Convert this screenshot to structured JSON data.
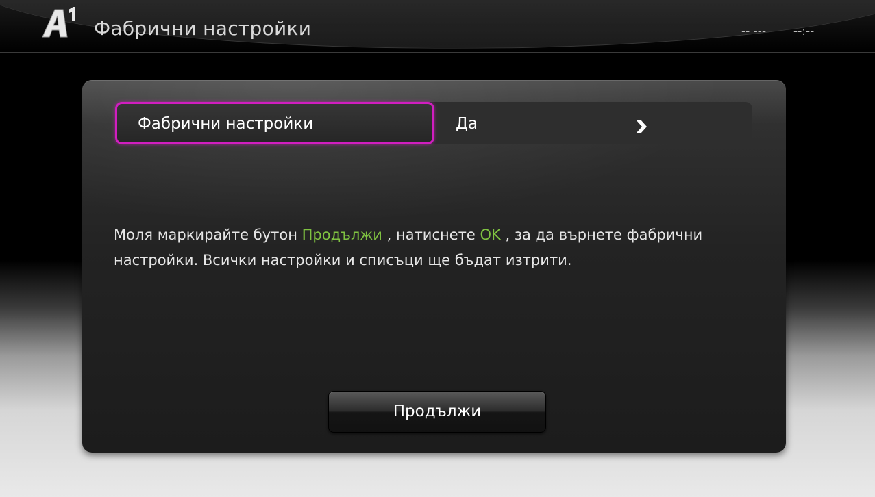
{
  "header": {
    "logo_text": "A1",
    "title": "Фабрични настройки",
    "date": "-- ---",
    "time": "--:--"
  },
  "setting": {
    "label": "Фабрични настройки",
    "value": "Да",
    "arrow_icon": "chevron-right-icon"
  },
  "message": {
    "part1": "Моля маркирайте бутон ",
    "highlight1": "Продължи",
    "part2": " , натиснете ",
    "highlight2": "OK",
    "part3": " , за да върнете фабрични настройки. Всички настройки и списъци ще бъдат изтрити."
  },
  "buttons": {
    "continue_label": "Продължи"
  },
  "colors": {
    "focus_border": "#d11ec0",
    "highlight_text": "#7fc241"
  }
}
